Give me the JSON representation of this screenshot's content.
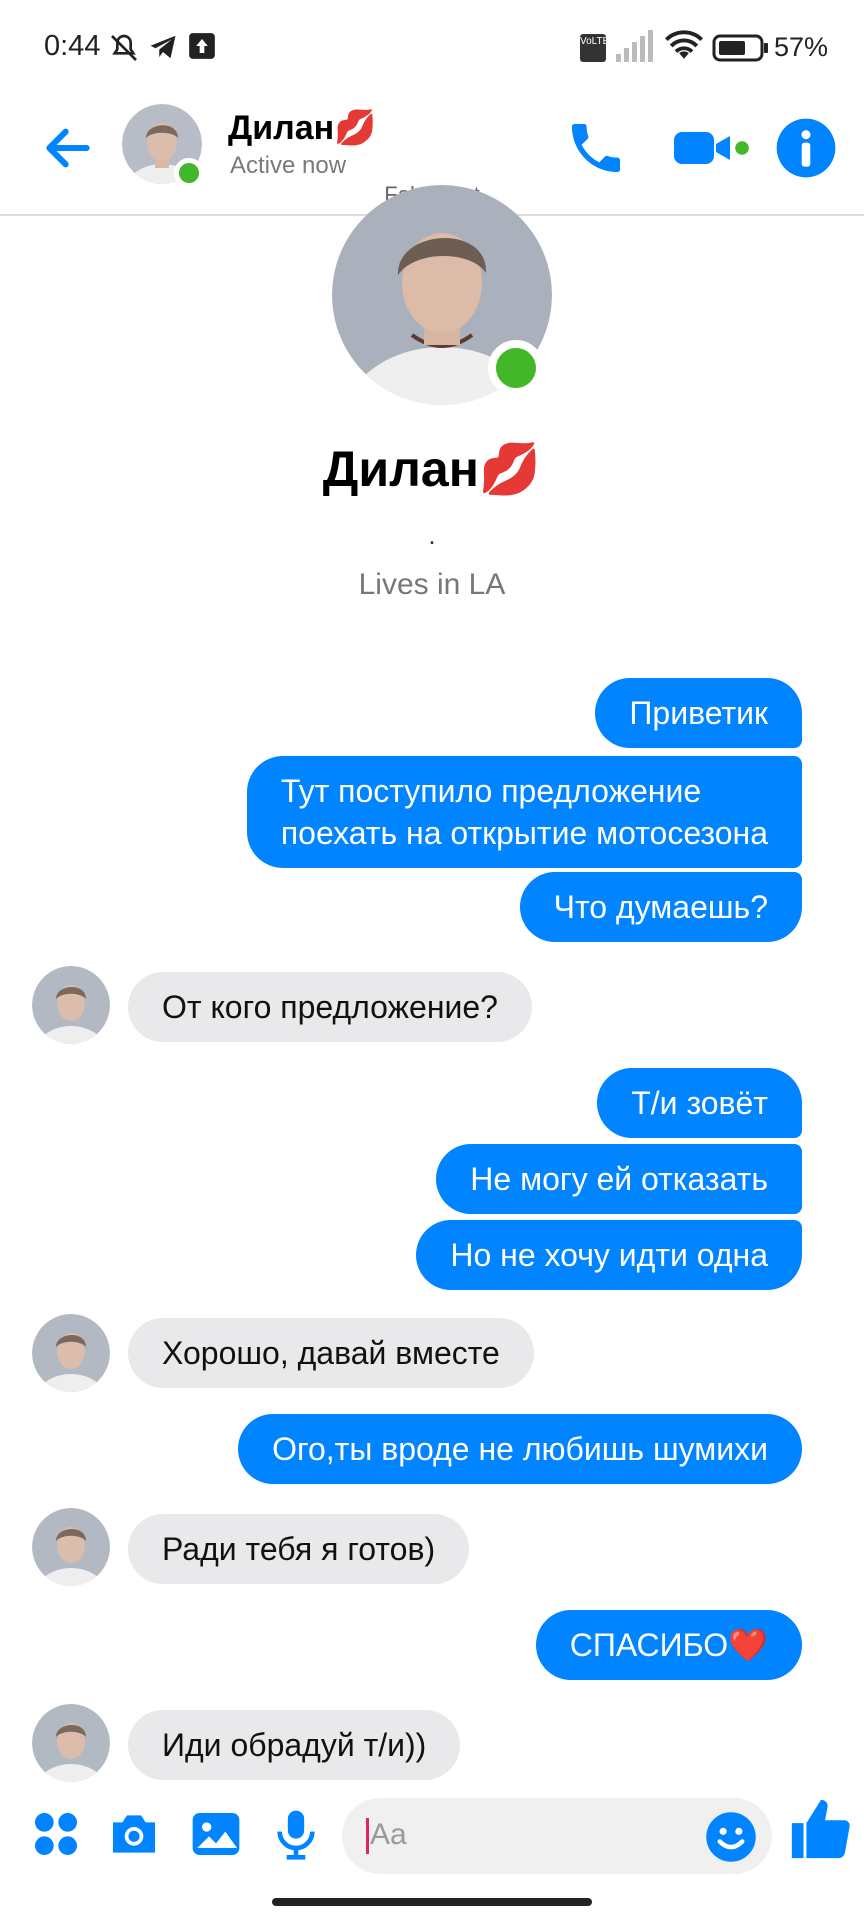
{
  "status_bar": {
    "time": "0:44",
    "battery_percent": "57%",
    "network": "VoLTE"
  },
  "header": {
    "contact_name": "Дилан💋",
    "status": "Active now",
    "watermark": "FakeChat",
    "icons": [
      "back-arrow-icon",
      "phone-icon",
      "video-camera-icon",
      "info-icon"
    ],
    "accent_color": "#0084ff",
    "online_color": "#42b72a"
  },
  "profile": {
    "name": "Дилан💋",
    "dot": ".",
    "bio": "Lives in LA"
  },
  "messages": [
    {
      "from": "me",
      "text": "Приветик"
    },
    {
      "from": "me",
      "text": "Тут поступило предложение",
      "text2": "поехать на открытие мотосезона"
    },
    {
      "from": "me",
      "text": "Что думаешь?"
    },
    {
      "from": "them",
      "text": "От кого предложение?"
    },
    {
      "from": "me",
      "text": "Т/и зовёт"
    },
    {
      "from": "me",
      "text": "Не могу ей отказать"
    },
    {
      "from": "me",
      "text": "Но не хочу идти одна"
    },
    {
      "from": "them",
      "text": "Хорошо, давай вместе"
    },
    {
      "from": "me",
      "text": "Ого,ты вроде не любишь шумихи"
    },
    {
      "from": "them",
      "text": "Ради тебя я готов)"
    },
    {
      "from": "me",
      "text": "СПАСИБО❤️"
    },
    {
      "from": "them",
      "text": "Иди обрадуй т/и))"
    }
  ],
  "composer": {
    "placeholder": "Aa",
    "icons": [
      "apps-grid-icon",
      "camera-icon",
      "gallery-icon",
      "microphone-icon",
      "emoji-icon",
      "thumbs-up-icon"
    ]
  }
}
